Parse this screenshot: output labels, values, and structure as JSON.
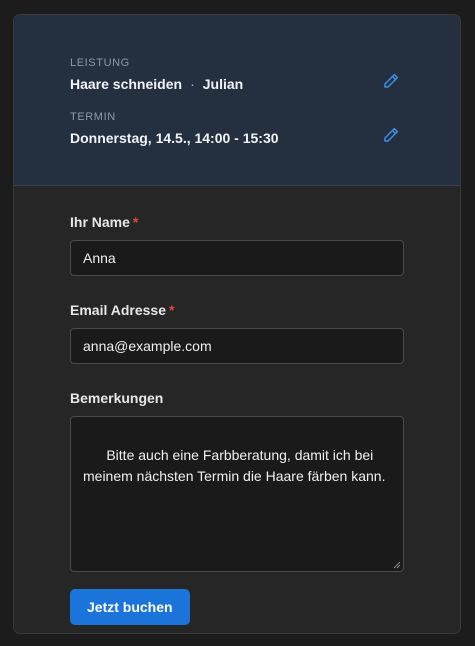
{
  "summary": {
    "service": {
      "label": "LEISTUNG",
      "name": "Haare schneiden",
      "separator": "·",
      "staff": "Julian",
      "edit_icon": "pencil-icon"
    },
    "appointment": {
      "label": "TERMIN",
      "value": "Donnerstag, 14.5., 14:00 - 15:30",
      "edit_icon": "pencil-icon"
    }
  },
  "form": {
    "name": {
      "label": "Ihr Name",
      "required_mark": "*",
      "value": "Anna"
    },
    "email": {
      "label": "Email Adresse",
      "required_mark": "*",
      "value": "anna@example.com"
    },
    "notes": {
      "label": "Bemerkungen",
      "value": "Bitte auch eine Farbberatung, damit ich bei meinem nächsten Termin die Haare färben kann."
    },
    "submit_label": "Jetzt buchen"
  },
  "colors": {
    "page_bg": "#1c1c1d",
    "card_bg": "#262627",
    "summary_bg": "#243040",
    "accent": "#1a74d9",
    "required": "#e0473b",
    "edit_icon": "#3d8de6"
  }
}
